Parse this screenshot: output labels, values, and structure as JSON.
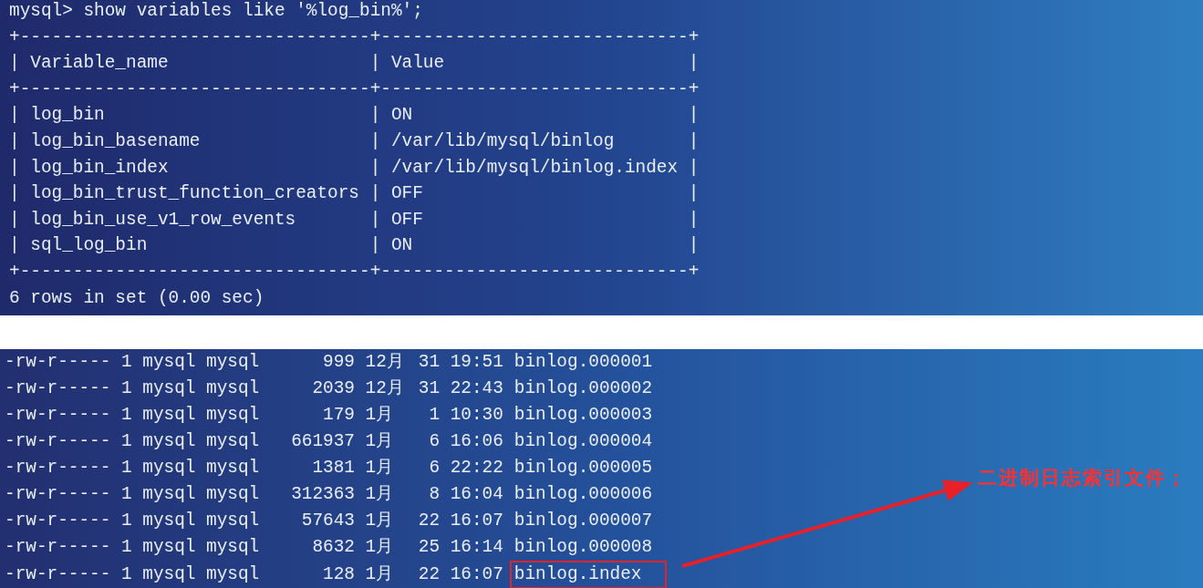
{
  "query_terminal": {
    "lines": [
      "mysql> show variables like '%log_bin%';",
      "+---------------------------------+-----------------------------+",
      "| Variable_name                   | Value                       |",
      "+---------------------------------+-----------------------------+",
      "| log_bin                         | ON                          |",
      "| log_bin_basename                | /var/lib/mysql/binlog       |",
      "| log_bin_index                   | /var/lib/mysql/binlog.index |",
      "| log_bin_trust_function_creators | OFF                         |",
      "| log_bin_use_v1_row_events       | OFF                         |",
      "| sql_log_bin                     | ON                          |",
      "+---------------------------------+-----------------------------+",
      "6 rows in set (0.00 sec)"
    ]
  },
  "listing_terminal": {
    "files": [
      {
        "permissions": "-rw-r-----",
        "links": "1",
        "owner": "mysql",
        "group": "mysql",
        "size": "999",
        "month": "12月",
        "day": "31",
        "time": "19:51",
        "name": "binlog.000001",
        "highlighted": false
      },
      {
        "permissions": "-rw-r-----",
        "links": "1",
        "owner": "mysql",
        "group": "mysql",
        "size": "2039",
        "month": "12月",
        "day": "31",
        "time": "22:43",
        "name": "binlog.000002",
        "highlighted": false
      },
      {
        "permissions": "-rw-r-----",
        "links": "1",
        "owner": "mysql",
        "group": "mysql",
        "size": "179",
        "month": "1月",
        "day": "1",
        "time": "10:30",
        "name": "binlog.000003",
        "highlighted": false
      },
      {
        "permissions": "-rw-r-----",
        "links": "1",
        "owner": "mysql",
        "group": "mysql",
        "size": "661937",
        "month": "1月",
        "day": "6",
        "time": "16:06",
        "name": "binlog.000004",
        "highlighted": false
      },
      {
        "permissions": "-rw-r-----",
        "links": "1",
        "owner": "mysql",
        "group": "mysql",
        "size": "1381",
        "month": "1月",
        "day": "6",
        "time": "22:22",
        "name": "binlog.000005",
        "highlighted": false
      },
      {
        "permissions": "-rw-r-----",
        "links": "1",
        "owner": "mysql",
        "group": "mysql",
        "size": "312363",
        "month": "1月",
        "day": "8",
        "time": "16:04",
        "name": "binlog.000006",
        "highlighted": false
      },
      {
        "permissions": "-rw-r-----",
        "links": "1",
        "owner": "mysql",
        "group": "mysql",
        "size": "57643",
        "month": "1月",
        "day": "22",
        "time": "16:07",
        "name": "binlog.000007",
        "highlighted": false
      },
      {
        "permissions": "-rw-r-----",
        "links": "1",
        "owner": "mysql",
        "group": "mysql",
        "size": "8632",
        "month": "1月",
        "day": "25",
        "time": "16:14",
        "name": "binlog.000008",
        "highlighted": false
      },
      {
        "permissions": "-rw-r-----",
        "links": "1",
        "owner": "mysql",
        "group": "mysql",
        "size": "128",
        "month": "1月",
        "day": "22",
        "time": "16:07",
        "name": "binlog.index",
        "highlighted": true
      }
    ]
  },
  "annotation": {
    "text": "二进制日志索引文件；"
  }
}
